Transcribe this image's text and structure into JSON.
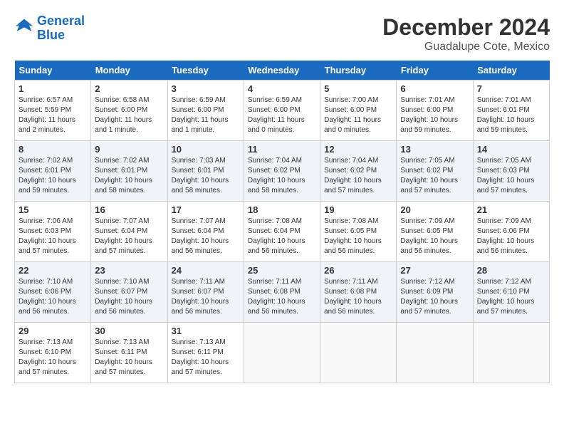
{
  "header": {
    "logo_line1": "General",
    "logo_line2": "Blue",
    "month": "December 2024",
    "location": "Guadalupe Cote, Mexico"
  },
  "days_of_week": [
    "Sunday",
    "Monday",
    "Tuesday",
    "Wednesday",
    "Thursday",
    "Friday",
    "Saturday"
  ],
  "weeks": [
    [
      {
        "day": "1",
        "content": "Sunrise: 6:57 AM\nSunset: 5:59 PM\nDaylight: 11 hours\nand 2 minutes."
      },
      {
        "day": "2",
        "content": "Sunrise: 6:58 AM\nSunset: 6:00 PM\nDaylight: 11 hours\nand 1 minute."
      },
      {
        "day": "3",
        "content": "Sunrise: 6:59 AM\nSunset: 6:00 PM\nDaylight: 11 hours\nand 1 minute."
      },
      {
        "day": "4",
        "content": "Sunrise: 6:59 AM\nSunset: 6:00 PM\nDaylight: 11 hours\nand 0 minutes."
      },
      {
        "day": "5",
        "content": "Sunrise: 7:00 AM\nSunset: 6:00 PM\nDaylight: 11 hours\nand 0 minutes."
      },
      {
        "day": "6",
        "content": "Sunrise: 7:01 AM\nSunset: 6:00 PM\nDaylight: 10 hours\nand 59 minutes."
      },
      {
        "day": "7",
        "content": "Sunrise: 7:01 AM\nSunset: 6:01 PM\nDaylight: 10 hours\nand 59 minutes."
      }
    ],
    [
      {
        "day": "8",
        "content": "Sunrise: 7:02 AM\nSunset: 6:01 PM\nDaylight: 10 hours\nand 59 minutes."
      },
      {
        "day": "9",
        "content": "Sunrise: 7:02 AM\nSunset: 6:01 PM\nDaylight: 10 hours\nand 58 minutes."
      },
      {
        "day": "10",
        "content": "Sunrise: 7:03 AM\nSunset: 6:01 PM\nDaylight: 10 hours\nand 58 minutes."
      },
      {
        "day": "11",
        "content": "Sunrise: 7:04 AM\nSunset: 6:02 PM\nDaylight: 10 hours\nand 58 minutes."
      },
      {
        "day": "12",
        "content": "Sunrise: 7:04 AM\nSunset: 6:02 PM\nDaylight: 10 hours\nand 57 minutes."
      },
      {
        "day": "13",
        "content": "Sunrise: 7:05 AM\nSunset: 6:02 PM\nDaylight: 10 hours\nand 57 minutes."
      },
      {
        "day": "14",
        "content": "Sunrise: 7:05 AM\nSunset: 6:03 PM\nDaylight: 10 hours\nand 57 minutes."
      }
    ],
    [
      {
        "day": "15",
        "content": "Sunrise: 7:06 AM\nSunset: 6:03 PM\nDaylight: 10 hours\nand 57 minutes."
      },
      {
        "day": "16",
        "content": "Sunrise: 7:07 AM\nSunset: 6:04 PM\nDaylight: 10 hours\nand 57 minutes."
      },
      {
        "day": "17",
        "content": "Sunrise: 7:07 AM\nSunset: 6:04 PM\nDaylight: 10 hours\nand 56 minutes."
      },
      {
        "day": "18",
        "content": "Sunrise: 7:08 AM\nSunset: 6:04 PM\nDaylight: 10 hours\nand 56 minutes."
      },
      {
        "day": "19",
        "content": "Sunrise: 7:08 AM\nSunset: 6:05 PM\nDaylight: 10 hours\nand 56 minutes."
      },
      {
        "day": "20",
        "content": "Sunrise: 7:09 AM\nSunset: 6:05 PM\nDaylight: 10 hours\nand 56 minutes."
      },
      {
        "day": "21",
        "content": "Sunrise: 7:09 AM\nSunset: 6:06 PM\nDaylight: 10 hours\nand 56 minutes."
      }
    ],
    [
      {
        "day": "22",
        "content": "Sunrise: 7:10 AM\nSunset: 6:06 PM\nDaylight: 10 hours\nand 56 minutes."
      },
      {
        "day": "23",
        "content": "Sunrise: 7:10 AM\nSunset: 6:07 PM\nDaylight: 10 hours\nand 56 minutes."
      },
      {
        "day": "24",
        "content": "Sunrise: 7:11 AM\nSunset: 6:07 PM\nDaylight: 10 hours\nand 56 minutes."
      },
      {
        "day": "25",
        "content": "Sunrise: 7:11 AM\nSunset: 6:08 PM\nDaylight: 10 hours\nand 56 minutes."
      },
      {
        "day": "26",
        "content": "Sunrise: 7:11 AM\nSunset: 6:08 PM\nDaylight: 10 hours\nand 56 minutes."
      },
      {
        "day": "27",
        "content": "Sunrise: 7:12 AM\nSunset: 6:09 PM\nDaylight: 10 hours\nand 57 minutes."
      },
      {
        "day": "28",
        "content": "Sunrise: 7:12 AM\nSunset: 6:10 PM\nDaylight: 10 hours\nand 57 minutes."
      }
    ],
    [
      {
        "day": "29",
        "content": "Sunrise: 7:13 AM\nSunset: 6:10 PM\nDaylight: 10 hours\nand 57 minutes."
      },
      {
        "day": "30",
        "content": "Sunrise: 7:13 AM\nSunset: 6:11 PM\nDaylight: 10 hours\nand 57 minutes."
      },
      {
        "day": "31",
        "content": "Sunrise: 7:13 AM\nSunset: 6:11 PM\nDaylight: 10 hours\nand 57 minutes."
      },
      {
        "day": "",
        "content": ""
      },
      {
        "day": "",
        "content": ""
      },
      {
        "day": "",
        "content": ""
      },
      {
        "day": "",
        "content": ""
      }
    ]
  ]
}
